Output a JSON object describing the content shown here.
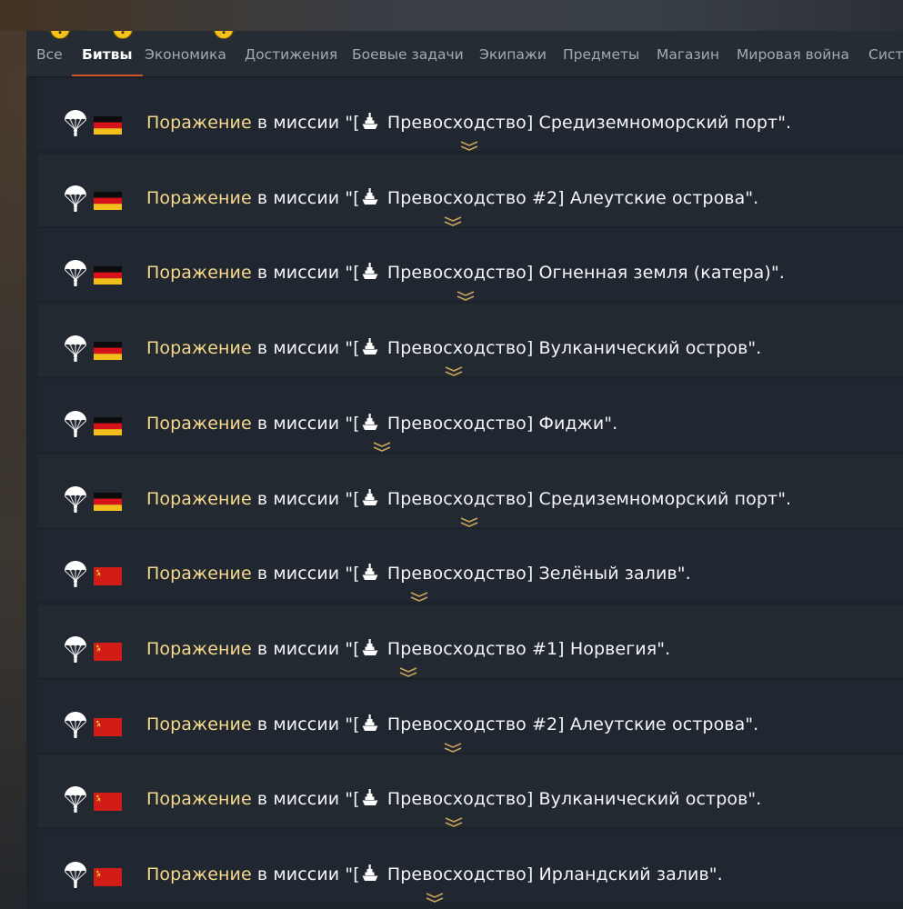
{
  "tabs": [
    {
      "label": "Все",
      "alert": true
    },
    {
      "label": "Битвы",
      "alert": true,
      "active": true
    },
    {
      "label": "Экономика",
      "alert": true
    },
    {
      "label": "Достижения",
      "alert": false
    },
    {
      "label": "Боевые задачи",
      "alert": false
    },
    {
      "label": "Экипажи",
      "alert": false
    },
    {
      "label": "Предметы",
      "alert": false
    },
    {
      "label": "Магазин",
      "alert": false
    },
    {
      "label": "Мировая война",
      "alert": false
    },
    {
      "label": "Систе",
      "alert": false
    }
  ],
  "alert_glyph": "!",
  "colors": {
    "defeat": "#f7d98b",
    "accent": "#d2542a",
    "alert": "#f4c21b"
  },
  "messages": [
    {
      "nation": "germany",
      "result": "Поражение",
      "middle": " в миссии \"[",
      "mission": " Превосходство] Средиземноморский порт\"."
    },
    {
      "nation": "germany",
      "result": "Поражение",
      "middle": " в миссии \"[",
      "mission": " Превосходство #2] Алеутские острова\"."
    },
    {
      "nation": "germany",
      "result": "Поражение",
      "middle": " в миссии \"[",
      "mission": " Превосходство] Огненная земля (катера)\"."
    },
    {
      "nation": "germany",
      "result": "Поражение",
      "middle": " в миссии \"[",
      "mission": " Превосходство] Вулканический остров\"."
    },
    {
      "nation": "germany",
      "result": "Поражение",
      "middle": " в миссии \"[",
      "mission": " Превосходство] Фиджи\"."
    },
    {
      "nation": "germany",
      "result": "Поражение",
      "middle": " в миссии \"[",
      "mission": " Превосходство] Средиземноморский порт\"."
    },
    {
      "nation": "ussr",
      "result": "Поражение",
      "middle": " в миссии \"[",
      "mission": " Превосходство] Зелёный залив\"."
    },
    {
      "nation": "ussr",
      "result": "Поражение",
      "middle": " в миссии \"[",
      "mission": " Превосходство #1] Норвегия\"."
    },
    {
      "nation": "ussr",
      "result": "Поражение",
      "middle": " в миссии \"[",
      "mission": " Превосходство #2] Алеутские острова\"."
    },
    {
      "nation": "ussr",
      "result": "Поражение",
      "middle": " в миссии \"[",
      "mission": " Превосходство] Вулканический остров\"."
    },
    {
      "nation": "ussr",
      "result": "Поражение",
      "middle": " в миссии \"[",
      "mission": " Превосходство] Ирландский залив\"."
    }
  ],
  "icons": {
    "row_status": "parachute-icon",
    "mission_type": "ship-icon",
    "expand": "chevron-double-down-icon"
  }
}
